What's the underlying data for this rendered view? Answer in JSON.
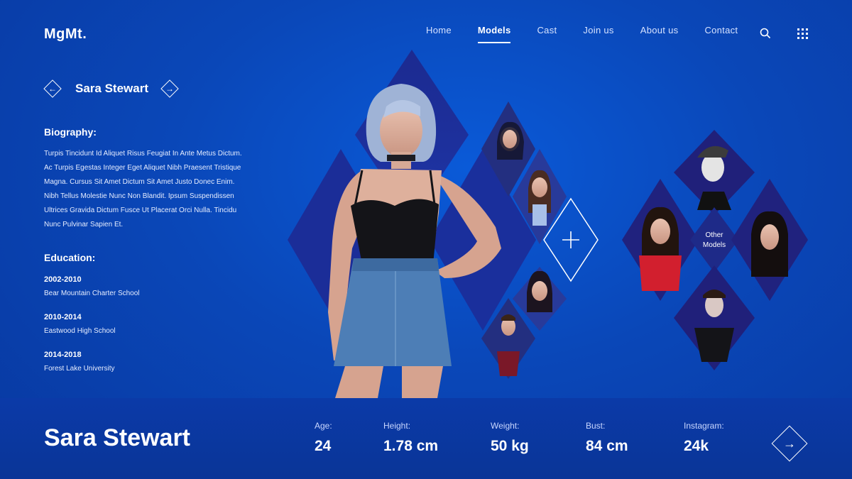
{
  "header": {
    "logo": "MgMt.",
    "nav": [
      {
        "label": "Home",
        "active": false
      },
      {
        "label": "Models",
        "active": true
      },
      {
        "label": "Cast",
        "active": false
      },
      {
        "label": "Join us",
        "active": false
      },
      {
        "label": "About us",
        "active": false
      },
      {
        "label": "Contact",
        "active": false
      }
    ],
    "search_icon": "search-icon",
    "menu_icon": "grid-menu-icon"
  },
  "profile": {
    "name": "Sara Stewart",
    "prev_icon": "arrow-left-icon",
    "next_icon": "arrow-right-icon",
    "biography_title": "Biography:",
    "biography_lines": [
      "Turpis Tincidunt Id Aliquet Risus Feugiat In Ante Metus Dictum.",
      "Ac Turpis Egestas Integer Eget Aliquet Nibh Praesent Tristique",
      "Magna. Cursus Sit Amet Dictum Sit Amet Justo Donec Enim.",
      "Nibh Tellus Molestie Nunc Non Blandit. Ipsum Suspendissen",
      "Ultrices Gravida Dictum Fusce Ut Placerat Orci Nulla. Tincidu",
      "Nunc Pulvinar Sapien Et."
    ],
    "education_title": "Education:",
    "education": [
      {
        "years": "2002-2010",
        "school": "Bear Mountain Charter School"
      },
      {
        "years": "2010-2014",
        "school": "Eastwood High School"
      },
      {
        "years": "2014-2018",
        "school": "Forest Lake University"
      }
    ]
  },
  "gallery": {
    "add_icon": "plus-icon",
    "other_models_line1": "Other",
    "other_models_line2": "Models"
  },
  "stats_bar": {
    "name": "Sara Stewart",
    "stats": [
      {
        "label": "Age:",
        "value": "24"
      },
      {
        "label": "Height:",
        "value": "1.78 cm"
      },
      {
        "label": "Weight:",
        "value": "50 kg"
      },
      {
        "label": "Bust:",
        "value": "84 cm"
      },
      {
        "label": "Instagram:",
        "value": "24k"
      }
    ],
    "next_icon": "arrow-right-icon"
  },
  "colors": {
    "background": "#0a47b8",
    "bar": "#0b3aa8",
    "diamond_dark": "#1a2a8c",
    "accent": "#ffffff"
  }
}
